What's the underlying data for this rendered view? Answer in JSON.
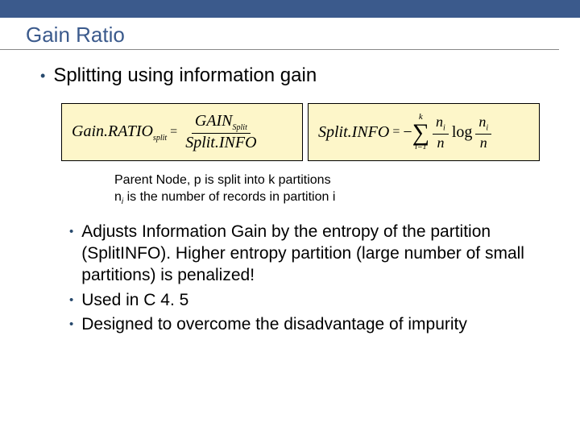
{
  "title": "Gain Ratio",
  "top_bullet": "Splitting using information gain",
  "formula1": {
    "lhs_name": "Gain.RATIO",
    "lhs_sub": "split",
    "num_name": "GAIN",
    "num_sub": "Split",
    "den_name": "Split.INFO"
  },
  "formula2": {
    "lhs_name": "Split.INFO",
    "sum_upper": "k",
    "sum_lower": "i=1",
    "frac_num_var": "n",
    "frac_num_sub": "i",
    "frac_den_var": "n",
    "log_label": "log"
  },
  "caption": {
    "line1": "Parent Node, p is split into k partitions",
    "line2_a": "n",
    "line2_sub": "i",
    "line2_b": " is the number of records in partition i"
  },
  "bullets": [
    "Adjusts Information Gain by the entropy of the partition (SplitINFO). Higher entropy partition (large number of small partitions) is penalized!",
    "Used in C 4. 5",
    "Designed to overcome the disadvantage of impurity"
  ]
}
